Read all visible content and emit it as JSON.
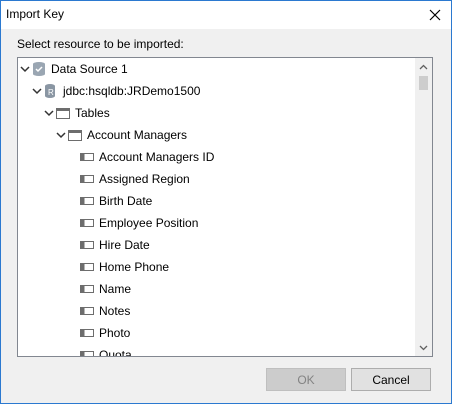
{
  "window": {
    "title": "Import Key"
  },
  "prompt": "Select resource to be imported:",
  "tree": {
    "nodes": [
      {
        "label": "Data Source 1",
        "icon": "database-checked-icon",
        "expanded": true
      },
      {
        "label": "jdbc:hsqldb:JRDemo1500",
        "icon": "database-icon",
        "expanded": true
      },
      {
        "label": "Tables",
        "icon": "folder-table-icon",
        "expanded": true
      },
      {
        "label": "Account Managers",
        "icon": "table-icon",
        "expanded": true
      },
      {
        "label": "Account Managers ID",
        "icon": "column-icon"
      },
      {
        "label": "Assigned Region",
        "icon": "column-icon"
      },
      {
        "label": "Birth Date",
        "icon": "column-icon"
      },
      {
        "label": "Employee Position",
        "icon": "column-icon"
      },
      {
        "label": "Hire Date",
        "icon": "column-icon"
      },
      {
        "label": "Home Phone",
        "icon": "column-icon"
      },
      {
        "label": "Name",
        "icon": "column-icon"
      },
      {
        "label": "Notes",
        "icon": "column-icon"
      },
      {
        "label": "Photo",
        "icon": "column-icon"
      },
      {
        "label": "Quota",
        "icon": "column-icon"
      }
    ]
  },
  "buttons": {
    "ok": "OK",
    "cancel": "Cancel"
  },
  "colors": {
    "border": "#2b79d0",
    "button_bg": "#e1e1e1",
    "disabled_text": "#838383"
  }
}
